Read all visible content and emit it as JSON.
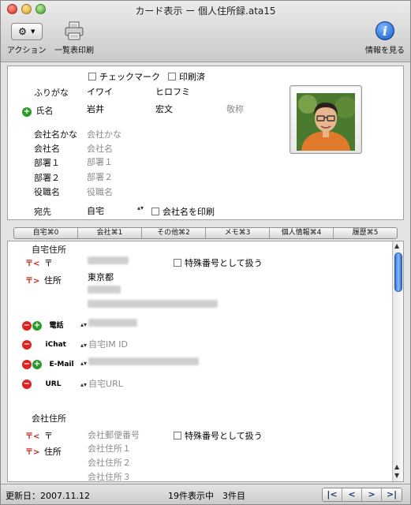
{
  "window": {
    "title": "カード表示 ー 個人住所録.ata15"
  },
  "toolbar": {
    "action_label": "アクション",
    "print_label": "一覧表印刷",
    "info_label": "情報を見る"
  },
  "card": {
    "checkmark_label": "チェックマーク",
    "printed_label": "印刷済",
    "furigana_label": "ふりがな",
    "furigana_last": "イワイ",
    "furigana_first": "ヒロフミ",
    "name_label": "氏名",
    "last_name": "岩井",
    "first_name": "宏文",
    "honorific_placeholder": "敬称",
    "company_kana_label": "会社名かな",
    "company_kana_placeholder": "会社かな",
    "company_label": "会社名",
    "company_placeholder": "会社名",
    "dept1_label": "部署１",
    "dept1_placeholder": "部署１",
    "dept2_label": "部署２",
    "dept2_placeholder": "部署２",
    "title_label": "役職名",
    "title_placeholder": "役職名",
    "address_to_label": "宛先",
    "address_to_value": "自宅",
    "print_company_label": "会社名を印刷"
  },
  "tabs": [
    {
      "label": "自宅⌘0"
    },
    {
      "label": "会社⌘1"
    },
    {
      "label": "その他⌘2"
    },
    {
      "label": "メモ⌘3"
    },
    {
      "label": "個人情報⌘4"
    },
    {
      "label": "履歴⌘5"
    }
  ],
  "home": {
    "section_label": "自宅住所",
    "zip_label": "〒",
    "special_number_label": "特殊番号として扱う",
    "address_label": "住所",
    "address_line1": "東京都",
    "phone_label": "電話",
    "ichat_label": "iChat",
    "ichat_placeholder": "自宅IM ID",
    "email_label": "E-Mail",
    "url_label": "URL",
    "url_placeholder": "自宅URL"
  },
  "office": {
    "section_label": "会社住所",
    "zip_label": "〒",
    "zip_placeholder": "会社郵便番号",
    "special_number_label": "特殊番号として扱う",
    "address_label": "住所",
    "address1_placeholder": "会社住所１",
    "address2_placeholder": "会社住所２",
    "address3_placeholder": "会社住所３"
  },
  "status": {
    "updated": "更新日：2007.11.12",
    "count": "19件表示中　3件目"
  },
  "nav": {
    "first": "|<",
    "prev": "<",
    "next": ">",
    "last": ">|"
  }
}
